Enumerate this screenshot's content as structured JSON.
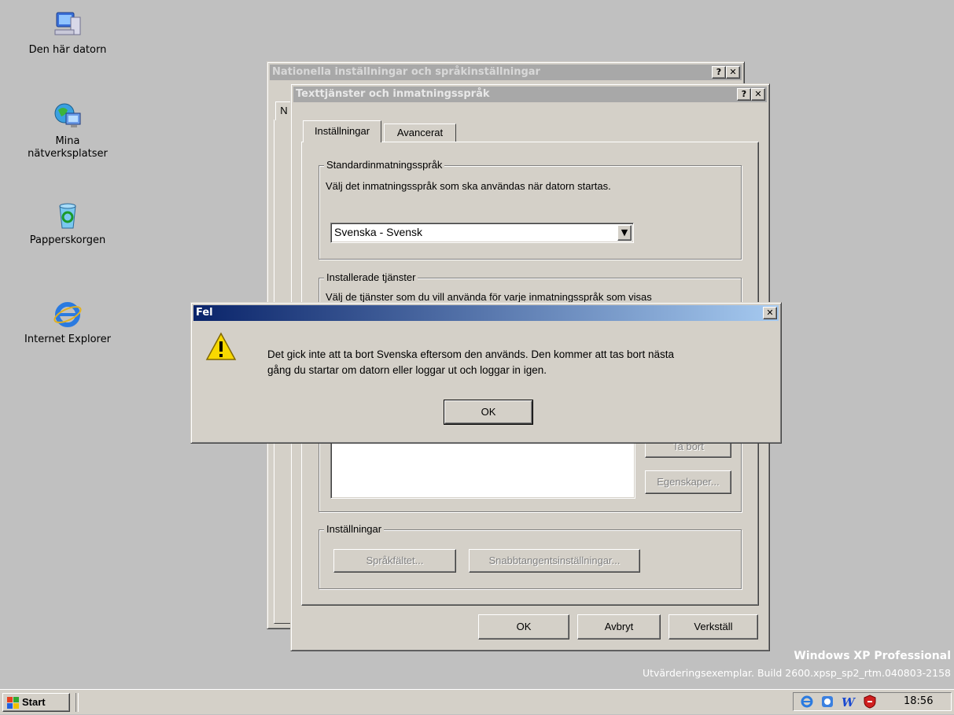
{
  "desktop": {
    "icons": [
      {
        "label": "Den här datorn"
      },
      {
        "label": "Mina\nnätverksplatser"
      },
      {
        "label": "Papperskorgen"
      },
      {
        "label": "Internet Explorer"
      }
    ],
    "watermark_title": "Windows XP Professional",
    "watermark_build": "Utvärderingsexemplar. Build 2600.xpsp_sp2_rtm.040803-2158"
  },
  "window_regional": {
    "title": "Nationella inställningar och språkinställningar",
    "tab_fragment": "N"
  },
  "window_text_services": {
    "title": "Texttjänster och inmatningsspråk",
    "tabs": [
      "Inställningar",
      "Avancerat"
    ],
    "default_lang_group": "Standardinmatningsspråk",
    "default_lang_desc": "Välj det inmatningsspråk som ska användas när datorn startas.",
    "default_lang_value": "Svenska - Svensk",
    "installed_group": "Installerade tjänster",
    "installed_desc": "Välj de tjänster som du vill använda för varje inmatningsspråk som visas",
    "remove_button": "Ta bort",
    "properties_button": "Egenskaper...",
    "settings_group": "Inställningar",
    "language_bar_button": "Språkfältet...",
    "hotkey_button": "Snabbtangentsinställningar...",
    "ok_button": "OK",
    "cancel_button": "Avbryt",
    "apply_button": "Verkställ"
  },
  "error_dialog": {
    "title": "Fel",
    "message_line1": "Det gick inte att ta bort Svenska eftersom den används. Den kommer att tas bort nästa",
    "message_line2": "gång du startar om datorn eller loggar ut och loggar in igen.",
    "ok_button": "OK"
  },
  "taskbar": {
    "start_label": "Start",
    "clock": "18:56"
  }
}
